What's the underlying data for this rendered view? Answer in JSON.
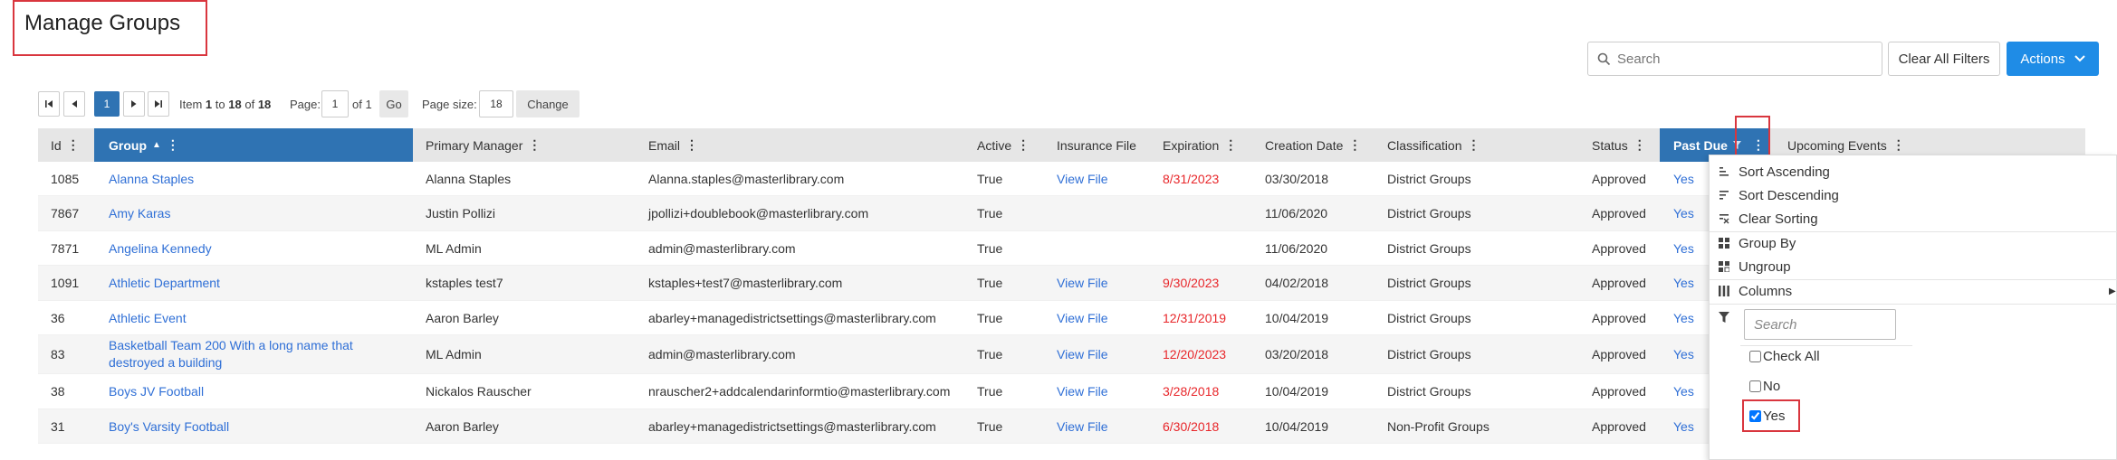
{
  "page": {
    "title": "Manage Groups"
  },
  "toolbar": {
    "search_placeholder": "Search",
    "clear_filters_label": "Clear All Filters",
    "actions_label": "Actions"
  },
  "pager": {
    "current_page": "1",
    "item_prefix": "Item",
    "item_from": "1",
    "to_word": "to",
    "item_to": "18",
    "of_word": "of",
    "item_total": "18",
    "page_label": "Page:",
    "page_value": "1",
    "page_of": "of 1",
    "go_label": "Go",
    "page_size_label": "Page size:",
    "page_size_value": "18",
    "change_label": "Change"
  },
  "columns": {
    "id": "Id",
    "group": "Group",
    "primary_manager": "Primary Manager",
    "email": "Email",
    "active": "Active",
    "insurance_file": "Insurance File",
    "expiration": "Expiration",
    "creation_date": "Creation Date",
    "classification": "Classification",
    "status": "Status",
    "past_due": "Past Due",
    "upcoming_events": "Upcoming Events"
  },
  "rows": [
    {
      "id": "1085",
      "group": "Alanna Staples",
      "manager": "Alanna Staples",
      "email": "Alanna.staples@masterlibrary.com",
      "active": "True",
      "insurance": "View File",
      "expiration": "8/31/2023",
      "created": "03/30/2018",
      "classification": "District Groups",
      "status": "Approved",
      "past_due": "Yes"
    },
    {
      "id": "7867",
      "group": "Amy Karas",
      "manager": "Justin Pollizi",
      "email": "jpollizi+doublebook@masterlibrary.com",
      "active": "True",
      "insurance": "",
      "expiration": "",
      "created": "11/06/2020",
      "classification": "District Groups",
      "status": "Approved",
      "past_due": "Yes"
    },
    {
      "id": "7871",
      "group": "Angelina Kennedy",
      "manager": "ML Admin",
      "email": "admin@masterlibrary.com",
      "active": "True",
      "insurance": "",
      "expiration": "",
      "created": "11/06/2020",
      "classification": "District Groups",
      "status": "Approved",
      "past_due": "Yes"
    },
    {
      "id": "1091",
      "group": "Athletic Department",
      "manager": "kstaples test7",
      "email": "kstaples+test7@masterlibrary.com",
      "active": "True",
      "insurance": "View File",
      "expiration": "9/30/2023",
      "created": "04/02/2018",
      "classification": "District Groups",
      "status": "Approved",
      "past_due": "Yes"
    },
    {
      "id": "36",
      "group": "Athletic Event",
      "manager": "Aaron Barley",
      "email": "abarley+managedistrictsettings@masterlibrary.com",
      "active": "True",
      "insurance": "View File",
      "expiration": "12/31/2019",
      "created": "10/04/2019",
      "classification": "District Groups",
      "status": "Approved",
      "past_due": "Yes"
    },
    {
      "id": "83",
      "group": "Basketball Team 200 With a long name that destroyed a building",
      "manager": "ML Admin",
      "email": "admin@masterlibrary.com",
      "active": "True",
      "insurance": "View File",
      "expiration": "12/20/2023",
      "created": "03/20/2018",
      "classification": "District Groups",
      "status": "Approved",
      "past_due": "Yes"
    },
    {
      "id": "38",
      "group": "Boys JV Football",
      "manager": "Nickalos Rauscher",
      "email": "nrauscher2+addcalendarinformtio@masterlibrary.com",
      "active": "True",
      "insurance": "View File",
      "expiration": "3/28/2018",
      "created": "10/04/2019",
      "classification": "District Groups",
      "status": "Approved",
      "past_due": "Yes"
    },
    {
      "id": "31",
      "group": "Boy's Varsity Football",
      "manager": "Aaron Barley",
      "email": "abarley+managedistrictsettings@masterlibrary.com",
      "active": "True",
      "insurance": "View File",
      "expiration": "6/30/2018",
      "created": "10/04/2019",
      "classification": "Non-Profit Groups",
      "status": "Approved",
      "past_due": "Yes"
    }
  ],
  "column_menu": {
    "sort_ascending": "Sort Ascending",
    "sort_descending": "Sort Descending",
    "clear_sorting": "Clear Sorting",
    "group_by": "Group By",
    "ungroup": "Ungroup",
    "columns": "Columns",
    "filter_search_placeholder": "Search",
    "check_all": "Check All",
    "option_no": "No",
    "option_yes": "Yes",
    "yes_checked": true,
    "no_checked": false
  },
  "colors": {
    "accent": "#2f73b3",
    "primary_button": "#1f8ce6",
    "link": "#2f6fd6",
    "expired": "#e8262a",
    "highlight_box": "#d9363e"
  }
}
